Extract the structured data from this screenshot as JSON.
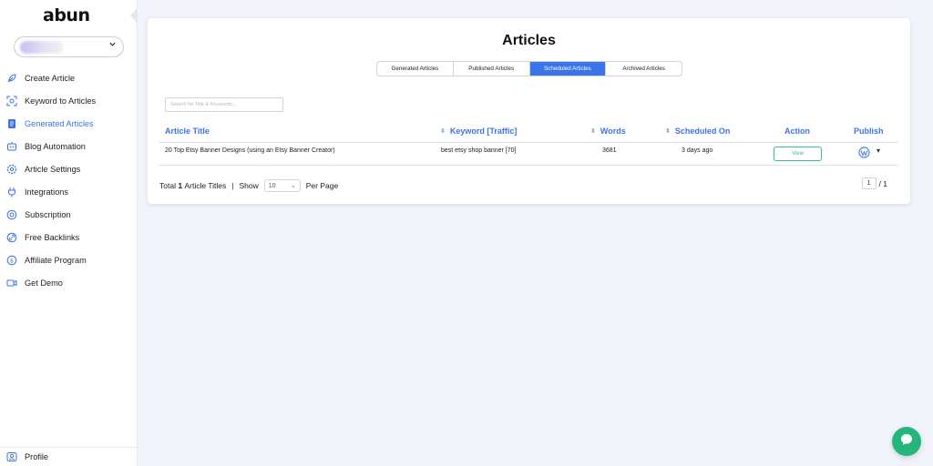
{
  "app": {
    "logo": "abun"
  },
  "sidebar": {
    "project_select": {
      "value": ""
    },
    "items": [
      {
        "label": "Create Article",
        "icon": "feather-icon"
      },
      {
        "label": "Keyword to Articles",
        "icon": "scan-icon"
      },
      {
        "label": "Generated Articles",
        "icon": "document-icon",
        "active": true
      },
      {
        "label": "Blog Automation",
        "icon": "robot-icon"
      },
      {
        "label": "Article Settings",
        "icon": "gear-icon"
      },
      {
        "label": "Integrations",
        "icon": "plug-icon"
      },
      {
        "label": "Subscription",
        "icon": "subscription-icon"
      },
      {
        "label": "Free Backlinks",
        "icon": "link-icon"
      },
      {
        "label": "Affiliate Program",
        "icon": "dollar-icon"
      },
      {
        "label": "Get Demo",
        "icon": "video-icon"
      }
    ],
    "profile": {
      "label": "Profile",
      "icon": "profile-icon"
    }
  },
  "main": {
    "title": "Articles",
    "tabs": [
      {
        "label": "Generated Articles",
        "active": false
      },
      {
        "label": "Published Articles",
        "active": false
      },
      {
        "label": "Scheduled Articles",
        "active": true
      },
      {
        "label": "Archived Articles",
        "active": false
      }
    ],
    "search": {
      "placeholder": "Search for Title & Keywords...",
      "value": ""
    },
    "table": {
      "columns": [
        "Article Title",
        "Keyword [Traffic]",
        "Words",
        "Scheduled On",
        "Action",
        "Publish"
      ],
      "rows": [
        {
          "title": "20 Top Etsy Banner Designs (using an Etsy Banner Creator)",
          "keyword": "best etsy shop banner [70]",
          "words": "3681",
          "scheduled_on": "3 days ago",
          "action": "View"
        }
      ]
    },
    "footer": {
      "total_prefix": "Total",
      "total_count": "1",
      "total_suffix": "Article Titles",
      "separator": "|",
      "show_label": "Show",
      "page_size": "10",
      "per_page_label": "Per Page",
      "current_page": "1",
      "total_pages": "/ 1"
    }
  },
  "colors": {
    "accent": "#3b73e8",
    "success": "#3bbf92",
    "chat": "#23b57a"
  }
}
